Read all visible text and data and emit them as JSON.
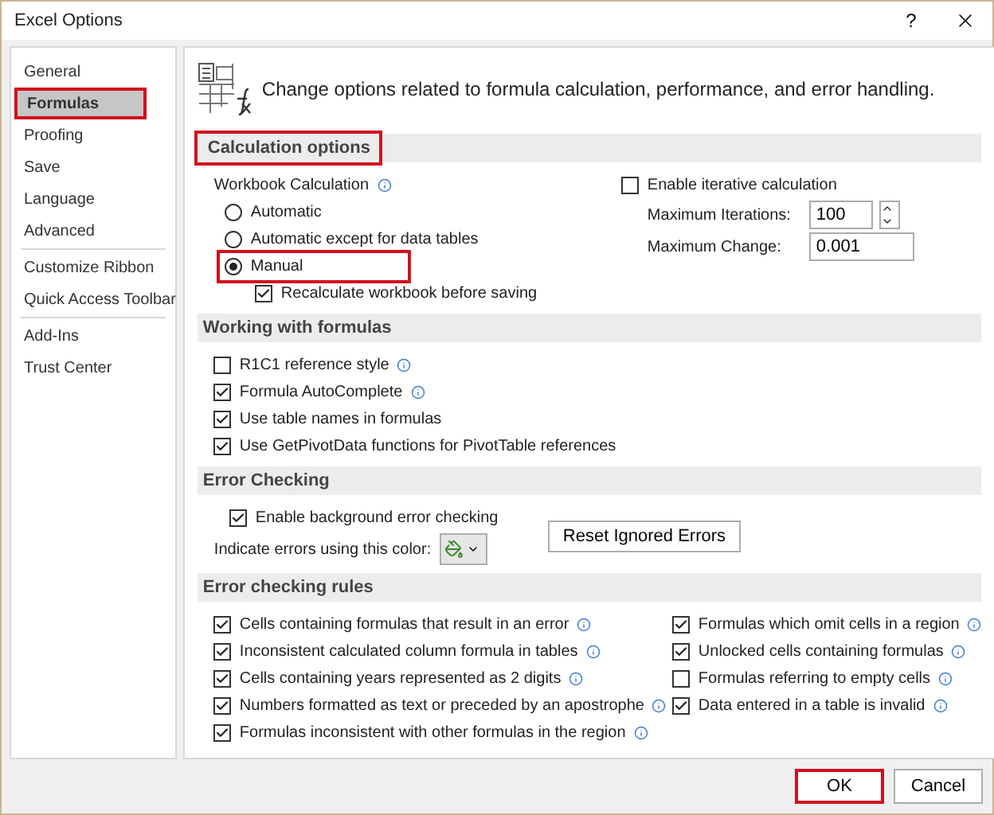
{
  "window": {
    "title": "Excel Options",
    "help": "?"
  },
  "sidebar": {
    "groups": [
      [
        {
          "label": "General",
          "selected": false,
          "highlighted": false
        },
        {
          "label": "Formulas",
          "selected": true,
          "highlighted": true
        },
        {
          "label": "Proofing",
          "selected": false,
          "highlighted": false
        },
        {
          "label": "Save",
          "selected": false,
          "highlighted": false
        },
        {
          "label": "Language",
          "selected": false,
          "highlighted": false
        },
        {
          "label": "Advanced",
          "selected": false,
          "highlighted": false
        }
      ],
      [
        {
          "label": "Customize Ribbon",
          "selected": false,
          "highlighted": false
        },
        {
          "label": "Quick Access Toolbar",
          "selected": false,
          "highlighted": false
        }
      ],
      [
        {
          "label": "Add-Ins",
          "selected": false,
          "highlighted": false
        },
        {
          "label": "Trust Center",
          "selected": false,
          "highlighted": false
        }
      ]
    ]
  },
  "header": {
    "text": "Change options related to formula calculation, performance, and error handling."
  },
  "calculation": {
    "title": "Calculation options",
    "highlighted": true,
    "workbook_label": "Workbook Calculation",
    "options": [
      {
        "label": "Automatic",
        "selected": false,
        "highlighted": false
      },
      {
        "label": "Automatic except for data tables",
        "selected": false,
        "highlighted": false
      },
      {
        "label": "Manual",
        "selected": true,
        "highlighted": true
      }
    ],
    "recalc": {
      "label": "Recalculate workbook before saving",
      "checked": true
    },
    "iterative": {
      "label": "Enable iterative calculation",
      "checked": false
    },
    "max_iterations": {
      "label": "Maximum Iterations:",
      "value": "100"
    },
    "max_change": {
      "label": "Maximum Change:",
      "value": "0.001"
    }
  },
  "working": {
    "title": "Working with formulas",
    "options": [
      {
        "label": "R1C1 reference style",
        "checked": false,
        "info": true
      },
      {
        "label": "Formula AutoComplete",
        "checked": true,
        "info": true
      },
      {
        "label": "Use table names in formulas",
        "checked": true,
        "info": false
      },
      {
        "label": "Use GetPivotData functions for PivotTable references",
        "checked": true,
        "info": false
      }
    ]
  },
  "error_checking": {
    "title": "Error Checking",
    "enable": {
      "label": "Enable background error checking",
      "checked": true
    },
    "color_label": "Indicate errors using this color:",
    "reset_button": "Reset Ignored Errors"
  },
  "rules": {
    "title": "Error checking rules",
    "columns": [
      [
        {
          "label": "Cells containing formulas that result in an error",
          "checked": true,
          "info": true
        },
        {
          "label": "Inconsistent calculated column formula in tables",
          "checked": true,
          "info": true
        },
        {
          "label": "Cells containing years represented as 2 digits",
          "checked": true,
          "info": true
        },
        {
          "label": "Numbers formatted as text or preceded by an apostrophe",
          "checked": true,
          "info": true
        },
        {
          "label": "Formulas inconsistent with other formulas in the region",
          "checked": true,
          "info": true
        }
      ],
      [
        {
          "label": "Formulas which omit cells in a region",
          "checked": true,
          "info": true
        },
        {
          "label": "Unlocked cells containing formulas",
          "checked": true,
          "info": true
        },
        {
          "label": "Formulas referring to empty cells",
          "checked": false,
          "info": true
        },
        {
          "label": "Data entered in a table is invalid",
          "checked": true,
          "info": true
        }
      ]
    ]
  },
  "buttons": [
    {
      "label": "OK",
      "highlighted": true
    },
    {
      "label": "Cancel",
      "highlighted": false
    }
  ]
}
